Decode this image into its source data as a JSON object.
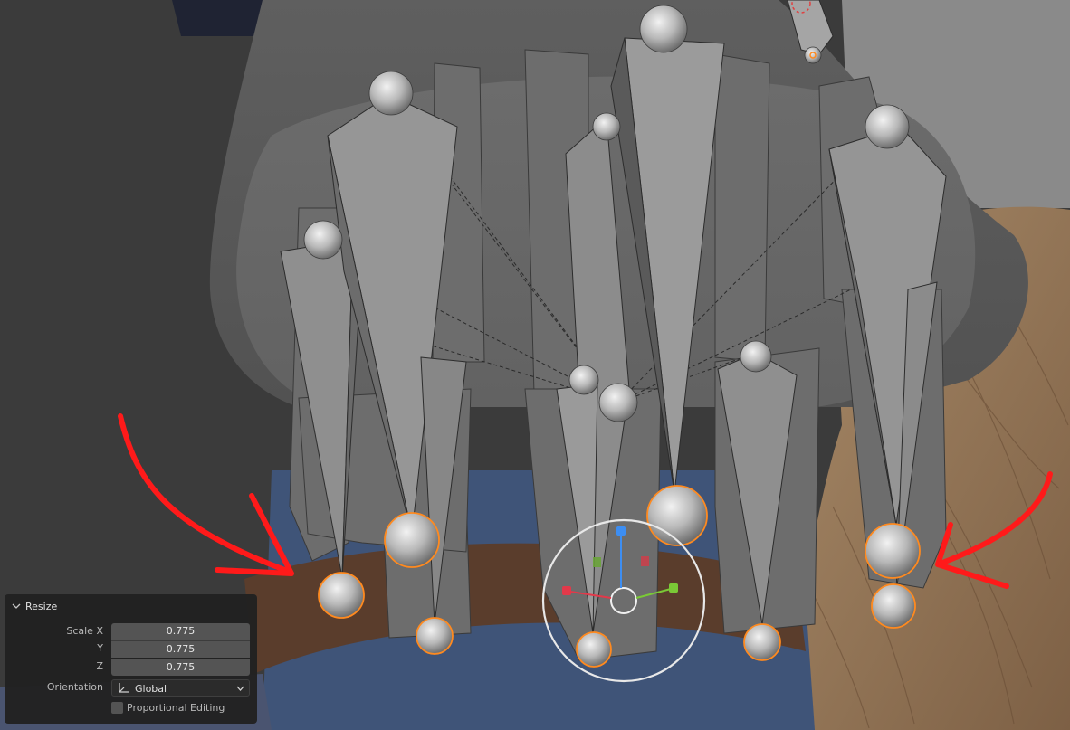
{
  "panel": {
    "title": "Resize",
    "scale_x_label": "Scale X",
    "scale_y_label": "Y",
    "scale_z_label": "Z",
    "scale_x": "0.775",
    "scale_y": "0.775",
    "scale_z": "0.775",
    "orientation_label": "Orientation",
    "orientation_value": "Global",
    "proportional_label": "Proportional Editing"
  },
  "colors": {
    "annotation": "#ff1a1a",
    "selected_outline": "#ff8a1f",
    "gizmo_x": "#e2394a",
    "gizmo_y": "#7ac936",
    "gizmo_z": "#3d8ef2"
  },
  "icons": [
    "chevron-down-icon",
    "orientation-axes-icon",
    "dropdown-arrow-icon"
  ]
}
